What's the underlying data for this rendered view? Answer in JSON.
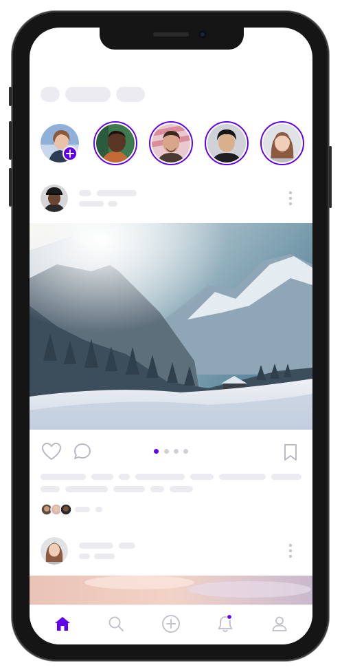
{
  "app": {
    "accent_color": "#6200ee",
    "skeleton_color": "#ececf0"
  },
  "header": {
    "placeholder": "loading-skeleton"
  },
  "stories": [
    {
      "name": "your-story",
      "has_add_badge": true
    },
    {
      "name": "story-2"
    },
    {
      "name": "story-3"
    },
    {
      "name": "story-4"
    },
    {
      "name": "story-5"
    }
  ],
  "posts": [
    {
      "image": "snowy-mountain-valley",
      "carousel_pages": 4,
      "carousel_active_index": 0
    },
    {
      "image": "pink-sky"
    }
  ],
  "bottom_nav": {
    "items": [
      {
        "icon": "home-icon",
        "active": true
      },
      {
        "icon": "search-icon"
      },
      {
        "icon": "add-circle-icon"
      },
      {
        "icon": "bell-icon",
        "has_badge": true
      },
      {
        "icon": "profile-icon"
      }
    ]
  }
}
